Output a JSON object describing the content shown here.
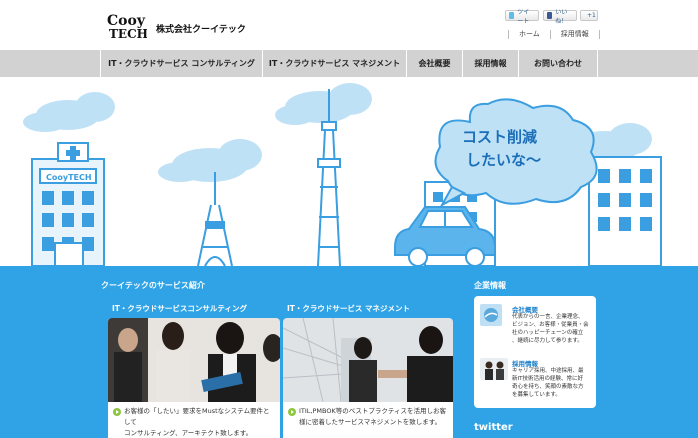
{
  "header": {
    "logo_text": [
      "Cooy",
      "TECH"
    ],
    "company_name": "株式会社クーイテック",
    "social": {
      "tweet": "ツイート",
      "like": "いいね！",
      "gplus": "+1"
    },
    "util_links": [
      "ホーム",
      "採用情報"
    ]
  },
  "nav": {
    "items": [
      "IT・クラウドサービス コンサルティング",
      "IT・クラウドサービス マネジメント",
      "会社概要",
      "採用情報",
      "お問い合わせ"
    ]
  },
  "hero": {
    "building_sign": "CooyTECH",
    "bubble_line1": "コスト削減",
    "bubble_line2": "したいな〜"
  },
  "services": {
    "title": "クーイテックのサービス紹介",
    "consulting": {
      "label": "IT・クラウドサービスコンサルティング",
      "desc1": "お客様の「したい」要求をMustなシステム要件として",
      "desc2": "コンサルティング、アーキテクト致します。"
    },
    "management": {
      "label": "IT・クラウドサービス マネジメント",
      "desc1": "ITIL,PMBOK等のベストプラクティスを活用しお客",
      "desc2": "様に密着したサービスマネジメントを致します。"
    }
  },
  "company": {
    "title": "企業情報",
    "overview": {
      "head": "会社概要",
      "lines": [
        "代表からの一言、企業理念、",
        "ビジョン、お客様・従業員・会",
        "社のハッピーチェーンの確立",
        "、継続に尽力して参ります。"
      ]
    },
    "recruit": {
      "head": "採用情報",
      "lines": [
        "キャリア採用、中途採用、最",
        "新IT技術活用の経験、常に好",
        "奇心を持ち、笑顔の素敵な方",
        "を募集しています。"
      ]
    }
  },
  "twitter": {
    "title": "twitter"
  },
  "colors": {
    "accent_blue": "#2fa3e6",
    "line_blue": "#3a9ee0",
    "nav_gray": "#d2d2d2",
    "arrow_green": "#8cc63f"
  }
}
